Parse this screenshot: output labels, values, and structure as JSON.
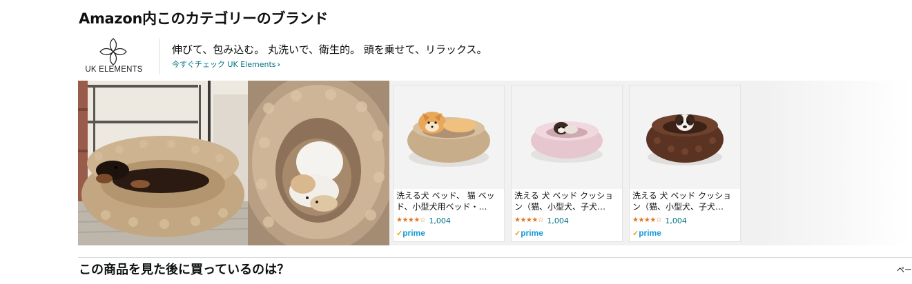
{
  "section_title": "Amazon内このカテゴリーのブランド",
  "brand": {
    "logo_text": "UK ELEMENTS",
    "headline": "伸びて、包み込む。 丸洗いで、衛生的。 頭を乗せて、リラックス。",
    "link_label": "今すぐチェック UK Elements",
    "link_chevron": "›"
  },
  "products": [
    {
      "title": "洗える犬 ベッド、 猫 ベッド、小型犬用ベッド・…",
      "stars": "★★★★☆",
      "rating_count": "1,004",
      "prime_check": "✓",
      "prime_label": "prime"
    },
    {
      "title": "洗える 犬 ベッド クッション（猫、小型犬、子犬…",
      "stars": "★★★★☆",
      "rating_count": "1,004",
      "prime_check": "✓",
      "prime_label": "prime"
    },
    {
      "title": "洗える 犬 ベッド クッション（猫、小型犬、子犬…",
      "stars": "★★★★☆",
      "rating_count": "1,004",
      "prime_check": "✓",
      "prime_label": "prime"
    }
  ],
  "colors": {
    "rating_star": "#de7921",
    "link": "#007185",
    "prime": "#1399d6",
    "prime_check": "#ff9900"
  },
  "icons": {
    "brand_logo": "four-petal-flower-icon",
    "star": "star-icon"
  },
  "bottom_section_title": "この商品を見た後に買っているのは？",
  "page_indicator": "ペー"
}
